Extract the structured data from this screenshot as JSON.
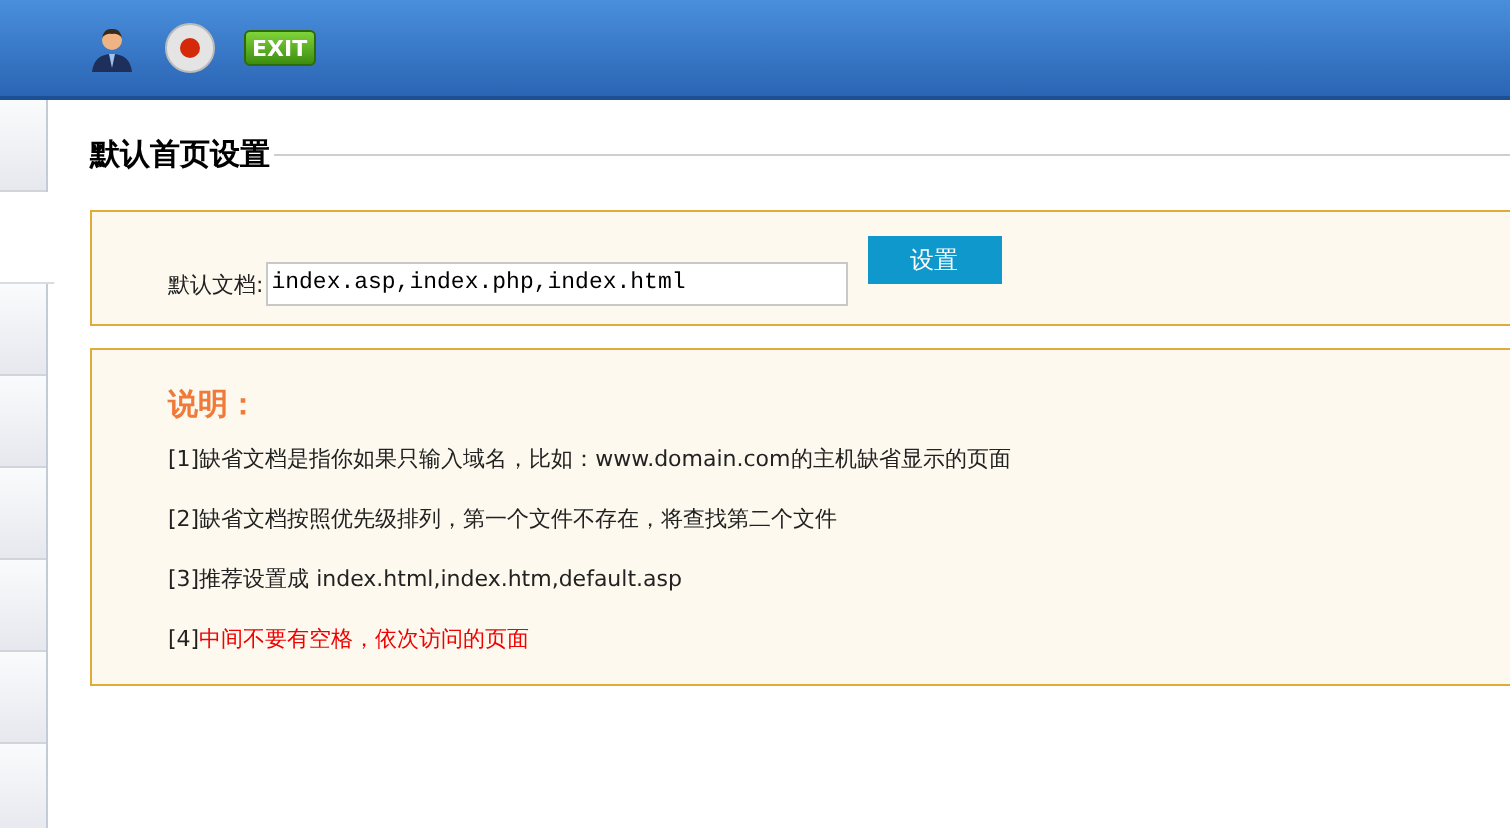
{
  "toolbar": {
    "exit_label": "EXIT"
  },
  "sidebar": {
    "tabs": [
      {
        "selected": false
      },
      {
        "selected": true
      },
      {
        "selected": false
      },
      {
        "selected": false
      },
      {
        "selected": false
      },
      {
        "selected": false
      },
      {
        "selected": false
      },
      {
        "selected": false
      }
    ]
  },
  "section_title": "默认首页设置",
  "form": {
    "label": "默认文档:",
    "value": "index.asp,index.php,index.html",
    "button": "设置"
  },
  "notes": {
    "title": "说明：",
    "items": [
      {
        "marker": "[1]",
        "text": "缺省文档是指你如果只输入域名，比如：www.domain.com的主机缺省显示的页面",
        "highlight": false
      },
      {
        "marker": "[2]",
        "text": "缺省文档按照优先级排列，第一个文件不存在，将查找第二个文件",
        "highlight": false
      },
      {
        "marker": "[3]",
        "text": "推荐设置成 index.html,index.htm,default.asp",
        "highlight": false
      },
      {
        "marker": "[4]",
        "text": "中间不要有空格，依次访问的页面",
        "highlight": true
      }
    ]
  }
}
